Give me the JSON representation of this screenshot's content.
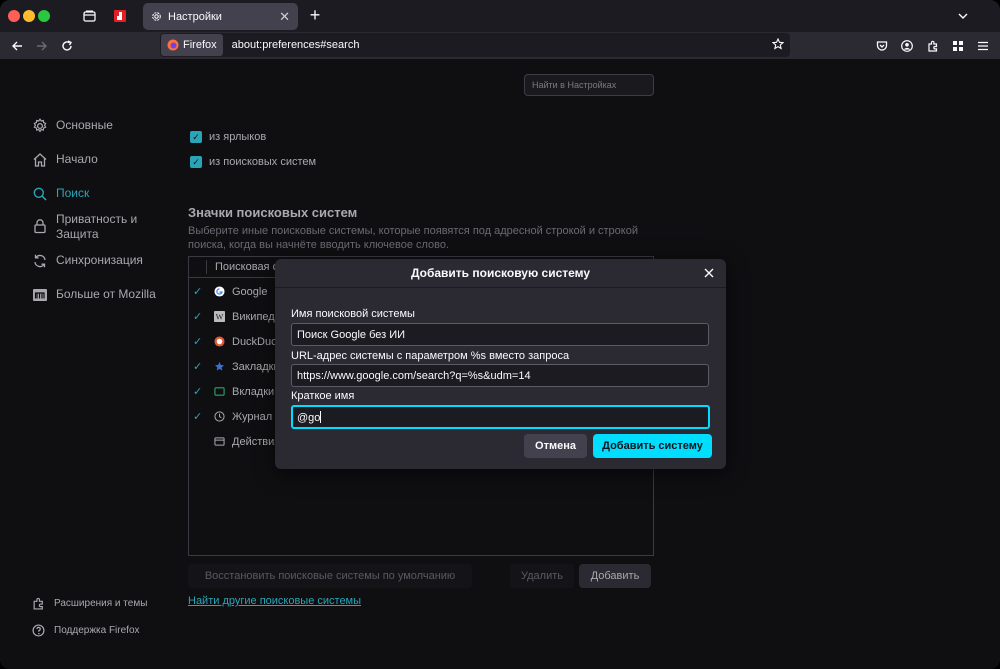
{
  "tabs": {
    "active_title": "Настройки"
  },
  "toolbar": {
    "identity_label": "Firefox",
    "url": "about:preferences#search"
  },
  "search_settings": {
    "placeholder": "Найти в Настройках"
  },
  "sidebar": {
    "items": [
      {
        "label": "Основные",
        "icon": "gear-icon"
      },
      {
        "label": "Начало",
        "icon": "home-icon"
      },
      {
        "label": "Поиск",
        "icon": "search-icon",
        "active": true
      },
      {
        "label": "Приватность и\nЗащита",
        "icon": "lock-icon"
      },
      {
        "label": "Синхронизация",
        "icon": "sync-icon"
      },
      {
        "label": "Больше от Mozilla",
        "icon": "mozilla-icon"
      }
    ],
    "footer": [
      {
        "label": "Расширения и темы",
        "icon": "puzzle-icon"
      },
      {
        "label": "Поддержка Firefox",
        "icon": "help-icon"
      }
    ]
  },
  "suggestions": {
    "checkboxes": [
      {
        "label": "из ярлыков",
        "checked": true
      },
      {
        "label": "из поисковых систем",
        "checked": true
      }
    ]
  },
  "engines": {
    "title": "Значки поисковых систем",
    "description": "Выберите иные поисковые системы, которые появятся под адресной строкой и строкой поиска, когда вы начнёте вводить ключевое слово.",
    "column_header": "Поисковая с",
    "rows": [
      {
        "name": "Google",
        "checked": true,
        "icon": "google-icon"
      },
      {
        "name": "Википеди",
        "checked": true,
        "icon": "wikipedia-icon"
      },
      {
        "name": "DuckDuck",
        "checked": true,
        "icon": "duckduckgo-icon"
      },
      {
        "name": "Закладки",
        "checked": true,
        "icon": "star-icon"
      },
      {
        "name": "Вкладки",
        "checked": true,
        "icon": "tab-icon"
      },
      {
        "name": "Журнал",
        "checked": true,
        "icon": "history-icon"
      },
      {
        "name": "Действия",
        "checked": false,
        "icon": "actions-icon"
      }
    ],
    "restore_label": "Восстановить поисковые системы по умолчанию",
    "remove_label": "Удалить",
    "add_label": "Добавить",
    "find_more_link": "Найти другие поисковые системы"
  },
  "dialog": {
    "title": "Добавить поисковую систему",
    "name_label": "Имя поисковой системы",
    "name_value": "Поиск Google без ИИ",
    "url_label": "URL-адрес системы с параметром %s вместо запроса",
    "url_value": "https://www.google.com/search?q=%s&udm=14",
    "alias_label": "Краткое имя",
    "alias_value": "@go",
    "cancel_label": "Отмена",
    "submit_label": "Добавить систему"
  },
  "colors": {
    "accent": "#00ddff",
    "accent_muted": "#2aa5b8",
    "panel": "#2b2a33",
    "background": "#0f0f12"
  }
}
